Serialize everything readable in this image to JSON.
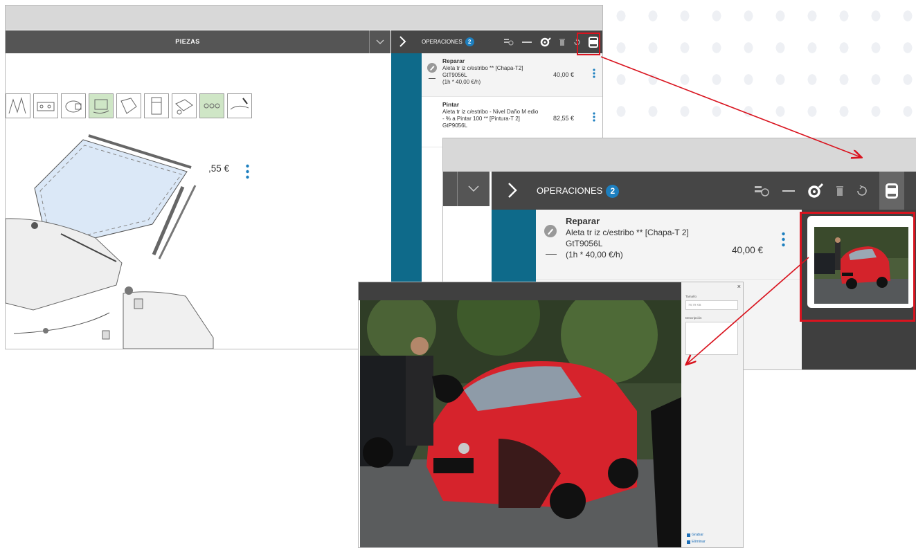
{
  "window1": {
    "piezas_label": "PIEZAS",
    "ops_title": "OPERACIONES",
    "ops_count": "2",
    "rows": [
      {
        "type": "Reparar",
        "desc": "Aleta tr iz c/estribo ** [Chapa-T2] GtT9056L",
        "calc": "(1h * 40,00 €/h)",
        "price": "40,00 €"
      },
      {
        "type": "Pintar",
        "desc": "Aleta tr iz c/estribo - Nivel Daño M edio - % a Pintar 100 ** [Pintura-T 2] GtP9056L",
        "price": "82,55 €"
      }
    ]
  },
  "window2": {
    "ops_title": "OPERACIONES",
    "ops_count": "2",
    "row": {
      "type": "Reparar",
      "desc": "Aleta tr iz c/estribo ** [Chapa-T 2] GtT9056L",
      "calc": "(1h * 40,00 €/h)",
      "price": "40,00 €"
    },
    "row2_price_partial": ",55 €"
  },
  "viewer": {
    "close": "×",
    "size_label": "Tamaño",
    "size_value": "78,79 KB",
    "desc_label": "Descripción",
    "save_label": "Grabar",
    "delete_label": "Eliminar"
  },
  "icons": [
    "chevron-right-icon",
    "calculator-search-icon",
    "minus-icon",
    "part-search-icon",
    "trash-icon",
    "undo-icon",
    "gallery-icon",
    "pencil-icon",
    "kebab-icon",
    "chevron-down-icon"
  ],
  "colors": {
    "header": "#464646",
    "teal": "#0e6a8a",
    "badge": "#1d7fbf",
    "highlight": "#d9141f"
  }
}
